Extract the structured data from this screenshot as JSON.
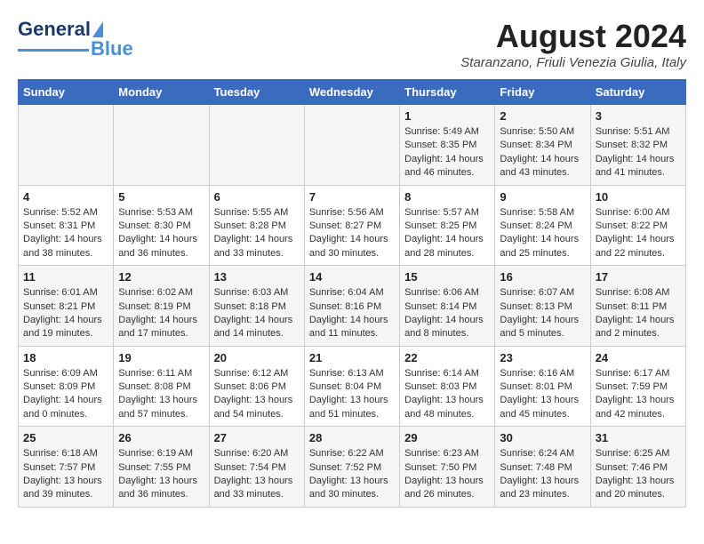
{
  "header": {
    "logo_general": "General",
    "logo_blue": "Blue",
    "month_year": "August 2024",
    "location": "Staranzano, Friuli Venezia Giulia, Italy"
  },
  "days_of_week": [
    "Sunday",
    "Monday",
    "Tuesday",
    "Wednesday",
    "Thursday",
    "Friday",
    "Saturday"
  ],
  "weeks": [
    [
      {
        "day": "",
        "content": ""
      },
      {
        "day": "",
        "content": ""
      },
      {
        "day": "",
        "content": ""
      },
      {
        "day": "",
        "content": ""
      },
      {
        "day": "1",
        "content": "Sunrise: 5:49 AM\nSunset: 8:35 PM\nDaylight: 14 hours\nand 46 minutes."
      },
      {
        "day": "2",
        "content": "Sunrise: 5:50 AM\nSunset: 8:34 PM\nDaylight: 14 hours\nand 43 minutes."
      },
      {
        "day": "3",
        "content": "Sunrise: 5:51 AM\nSunset: 8:32 PM\nDaylight: 14 hours\nand 41 minutes."
      }
    ],
    [
      {
        "day": "4",
        "content": "Sunrise: 5:52 AM\nSunset: 8:31 PM\nDaylight: 14 hours\nand 38 minutes."
      },
      {
        "day": "5",
        "content": "Sunrise: 5:53 AM\nSunset: 8:30 PM\nDaylight: 14 hours\nand 36 minutes."
      },
      {
        "day": "6",
        "content": "Sunrise: 5:55 AM\nSunset: 8:28 PM\nDaylight: 14 hours\nand 33 minutes."
      },
      {
        "day": "7",
        "content": "Sunrise: 5:56 AM\nSunset: 8:27 PM\nDaylight: 14 hours\nand 30 minutes."
      },
      {
        "day": "8",
        "content": "Sunrise: 5:57 AM\nSunset: 8:25 PM\nDaylight: 14 hours\nand 28 minutes."
      },
      {
        "day": "9",
        "content": "Sunrise: 5:58 AM\nSunset: 8:24 PM\nDaylight: 14 hours\nand 25 minutes."
      },
      {
        "day": "10",
        "content": "Sunrise: 6:00 AM\nSunset: 8:22 PM\nDaylight: 14 hours\nand 22 minutes."
      }
    ],
    [
      {
        "day": "11",
        "content": "Sunrise: 6:01 AM\nSunset: 8:21 PM\nDaylight: 14 hours\nand 19 minutes."
      },
      {
        "day": "12",
        "content": "Sunrise: 6:02 AM\nSunset: 8:19 PM\nDaylight: 14 hours\nand 17 minutes."
      },
      {
        "day": "13",
        "content": "Sunrise: 6:03 AM\nSunset: 8:18 PM\nDaylight: 14 hours\nand 14 minutes."
      },
      {
        "day": "14",
        "content": "Sunrise: 6:04 AM\nSunset: 8:16 PM\nDaylight: 14 hours\nand 11 minutes."
      },
      {
        "day": "15",
        "content": "Sunrise: 6:06 AM\nSunset: 8:14 PM\nDaylight: 14 hours\nand 8 minutes."
      },
      {
        "day": "16",
        "content": "Sunrise: 6:07 AM\nSunset: 8:13 PM\nDaylight: 14 hours\nand 5 minutes."
      },
      {
        "day": "17",
        "content": "Sunrise: 6:08 AM\nSunset: 8:11 PM\nDaylight: 14 hours\nand 2 minutes."
      }
    ],
    [
      {
        "day": "18",
        "content": "Sunrise: 6:09 AM\nSunset: 8:09 PM\nDaylight: 14 hours\nand 0 minutes."
      },
      {
        "day": "19",
        "content": "Sunrise: 6:11 AM\nSunset: 8:08 PM\nDaylight: 13 hours\nand 57 minutes."
      },
      {
        "day": "20",
        "content": "Sunrise: 6:12 AM\nSunset: 8:06 PM\nDaylight: 13 hours\nand 54 minutes."
      },
      {
        "day": "21",
        "content": "Sunrise: 6:13 AM\nSunset: 8:04 PM\nDaylight: 13 hours\nand 51 minutes."
      },
      {
        "day": "22",
        "content": "Sunrise: 6:14 AM\nSunset: 8:03 PM\nDaylight: 13 hours\nand 48 minutes."
      },
      {
        "day": "23",
        "content": "Sunrise: 6:16 AM\nSunset: 8:01 PM\nDaylight: 13 hours\nand 45 minutes."
      },
      {
        "day": "24",
        "content": "Sunrise: 6:17 AM\nSunset: 7:59 PM\nDaylight: 13 hours\nand 42 minutes."
      }
    ],
    [
      {
        "day": "25",
        "content": "Sunrise: 6:18 AM\nSunset: 7:57 PM\nDaylight: 13 hours\nand 39 minutes."
      },
      {
        "day": "26",
        "content": "Sunrise: 6:19 AM\nSunset: 7:55 PM\nDaylight: 13 hours\nand 36 minutes."
      },
      {
        "day": "27",
        "content": "Sunrise: 6:20 AM\nSunset: 7:54 PM\nDaylight: 13 hours\nand 33 minutes."
      },
      {
        "day": "28",
        "content": "Sunrise: 6:22 AM\nSunset: 7:52 PM\nDaylight: 13 hours\nand 30 minutes."
      },
      {
        "day": "29",
        "content": "Sunrise: 6:23 AM\nSunset: 7:50 PM\nDaylight: 13 hours\nand 26 minutes."
      },
      {
        "day": "30",
        "content": "Sunrise: 6:24 AM\nSunset: 7:48 PM\nDaylight: 13 hours\nand 23 minutes."
      },
      {
        "day": "31",
        "content": "Sunrise: 6:25 AM\nSunset: 7:46 PM\nDaylight: 13 hours\nand 20 minutes."
      }
    ]
  ]
}
